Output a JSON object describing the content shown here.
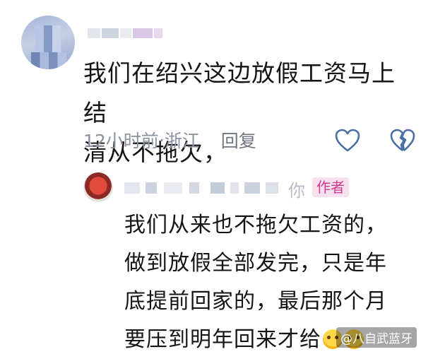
{
  "comment": {
    "text_line1": "我们在绍兴这边放假工资马上结",
    "text_line2": "清从不拖欠，",
    "time": "12小时前",
    "separator": " · ",
    "location": "浙江",
    "reply_label": "回复",
    "like_icon": "heart-outline-icon",
    "dislike_icon": "broken-heart-icon"
  },
  "reply": {
    "name_tail": "你",
    "badge": "作者",
    "text_line1": "我们从来也不拖欠工资的，",
    "text_line2": "做到放假全部发完，只是年",
    "text_line3": "底提前回家的，最后那个月",
    "text_line4": "要压到明年回来才给"
  },
  "watermark": "@八自武蓝牙",
  "colors": {
    "meta_gray": "#8b93a0",
    "badge_bg": "#f8e1ef",
    "badge_text": "#d0388f",
    "icon_blue": "#4a6fa5"
  }
}
